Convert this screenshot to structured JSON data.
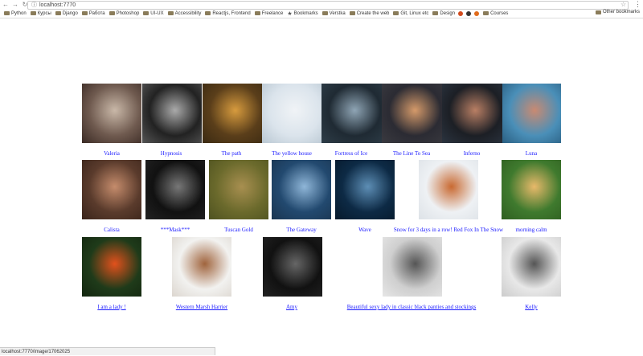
{
  "browser": {
    "url": "localhost:7770",
    "back_icon": "arrow-left-icon",
    "forward_icon": "arrow-right-icon",
    "reload_icon": "reload-icon",
    "bookmarks": [
      "Python",
      "Курсы",
      "Django",
      "Работа",
      "Photoshop",
      "UI-UX",
      "Accessibility",
      "Reactjs, Frontend",
      "Freelance",
      "Bookmarks",
      "Verstka",
      "Create the web",
      "Git, Linux etc",
      "Design",
      "",
      "",
      "",
      "Courses"
    ],
    "other_bookmarks": "Other bookmarks"
  },
  "gallery": {
    "row1": [
      {
        "title": "Valeria",
        "colors": [
          "#6f5a4f",
          "#c9b8a8",
          "#3a2a24"
        ]
      },
      {
        "title": "Hypnosis",
        "colors": [
          "#222",
          "#aaa",
          "#555"
        ]
      },
      {
        "title": "The path",
        "colors": [
          "#5a3e1a",
          "#d79b3e",
          "#3b2a12"
        ]
      },
      {
        "title": "The yellow house",
        "colors": [
          "#dbe4ec",
          "#f0f3f6",
          "#b9c7d2"
        ]
      },
      {
        "title": "Fortress of Ice",
        "colors": [
          "#1f2a33",
          "#8fa5b5",
          "#2e3d48"
        ]
      },
      {
        "title": "The Line To Sea",
        "colors": [
          "#2b2b33",
          "#d59a6a",
          "#3a3a40"
        ]
      },
      {
        "title": "Inferno",
        "colors": [
          "#1c1f25",
          "#b97f64",
          "#2b3440"
        ]
      },
      {
        "title": "Luna",
        "colors": [
          "#4a8fb8",
          "#c98a72",
          "#2a5f82"
        ]
      }
    ],
    "row2": [
      {
        "title": "Calista",
        "colors": [
          "#5a3b2c",
          "#c58c6c",
          "#3a241a"
        ]
      },
      {
        "title": "***Mask***",
        "colors": [
          "#111",
          "#777",
          "#222"
        ]
      },
      {
        "title": "Tuscan Gold",
        "colors": [
          "#6b6a2c",
          "#a88f50",
          "#4e5220"
        ]
      },
      {
        "title": "The Gateway",
        "colors": [
          "#22496f",
          "#8fb6d8",
          "#1a3550"
        ]
      },
      {
        "title": "Wave",
        "colors": [
          "#0d2a45",
          "#5d8eb5",
          "#06192b"
        ]
      },
      {
        "title": "Snow for 3 days in a row! Red Fox In The Snow",
        "colors": [
          "#eef1f4",
          "#c96a32",
          "#dde2e7"
        ]
      },
      {
        "title": "morning calm",
        "colors": [
          "#3f7a2e",
          "#e8b96a",
          "#2f5f20"
        ]
      }
    ],
    "row3": [
      {
        "title": "I am a lady !",
        "colors": [
          "#1f3b1a",
          "#e2511c",
          "#13260f"
        ]
      },
      {
        "title": "Western Marsh Harrier",
        "colors": [
          "#f2f2f0",
          "#a0643d",
          "#dcd6cf"
        ]
      },
      {
        "title": "Amy",
        "colors": [
          "#111",
          "#666",
          "#222"
        ]
      },
      {
        "title": "Beautiful sexy lady in classic black panties and stockings",
        "colors": [
          "#cfcfcf",
          "#555",
          "#e6e6e6"
        ]
      },
      {
        "title": "Kelly",
        "colors": [
          "#e8e8e8",
          "#555",
          "#ccc"
        ]
      }
    ]
  },
  "status_text": "localhost:7770/image/17062025"
}
